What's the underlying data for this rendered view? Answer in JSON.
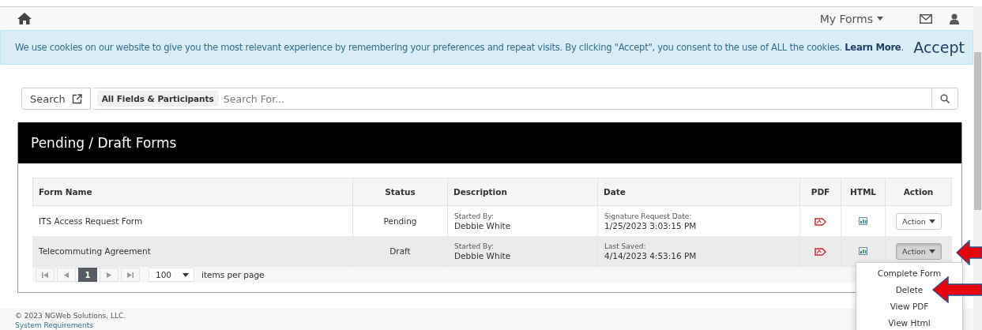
{
  "nav": {
    "menu": "My Forms"
  },
  "cookie_banner": {
    "text": "We use cookies on our website to give you the most relevant experience by remembering your preferences and repeat visits. By clicking \"Accept\", you consent to the use of ALL the cookies. **Learn More**.",
    "button": "Accept"
  },
  "search": {
    "label": "Search",
    "scope": "All Fields & Participants",
    "placeholder": "Search For..."
  },
  "panel": {
    "title": "Pending / Draft Forms"
  },
  "table": {
    "columns": [
      "Form Name",
      "Status",
      "Description",
      "Date",
      "PDF",
      "HTML",
      "Action"
    ],
    "rows": [
      {
        "form_name": "ITS Access Request Form",
        "status": "Pending",
        "description_label": "Started By:",
        "description": "Debbie White",
        "date_label": "Signature Request Date:",
        "date": "1/25/2023 3:03:15 PM",
        "action": "Action",
        "selected": false
      },
      {
        "form_name": "Telecommuting Agreement",
        "status": "Draft",
        "description_label": "Started By:",
        "description": "Debbie White",
        "date_label": "Last Saved:",
        "date": "4/14/2023 4:53:16 PM",
        "action": "Action",
        "selected": true
      }
    ]
  },
  "pager": {
    "page": "1",
    "page_size": "100",
    "label": "items per page"
  },
  "action_menu": [
    "Complete Form",
    "Delete",
    "View PDF",
    "View Html"
  ],
  "footer": {
    "copyright": "© 2023 NGWeb Solutions, LLC.",
    "link": "System Requirements"
  }
}
